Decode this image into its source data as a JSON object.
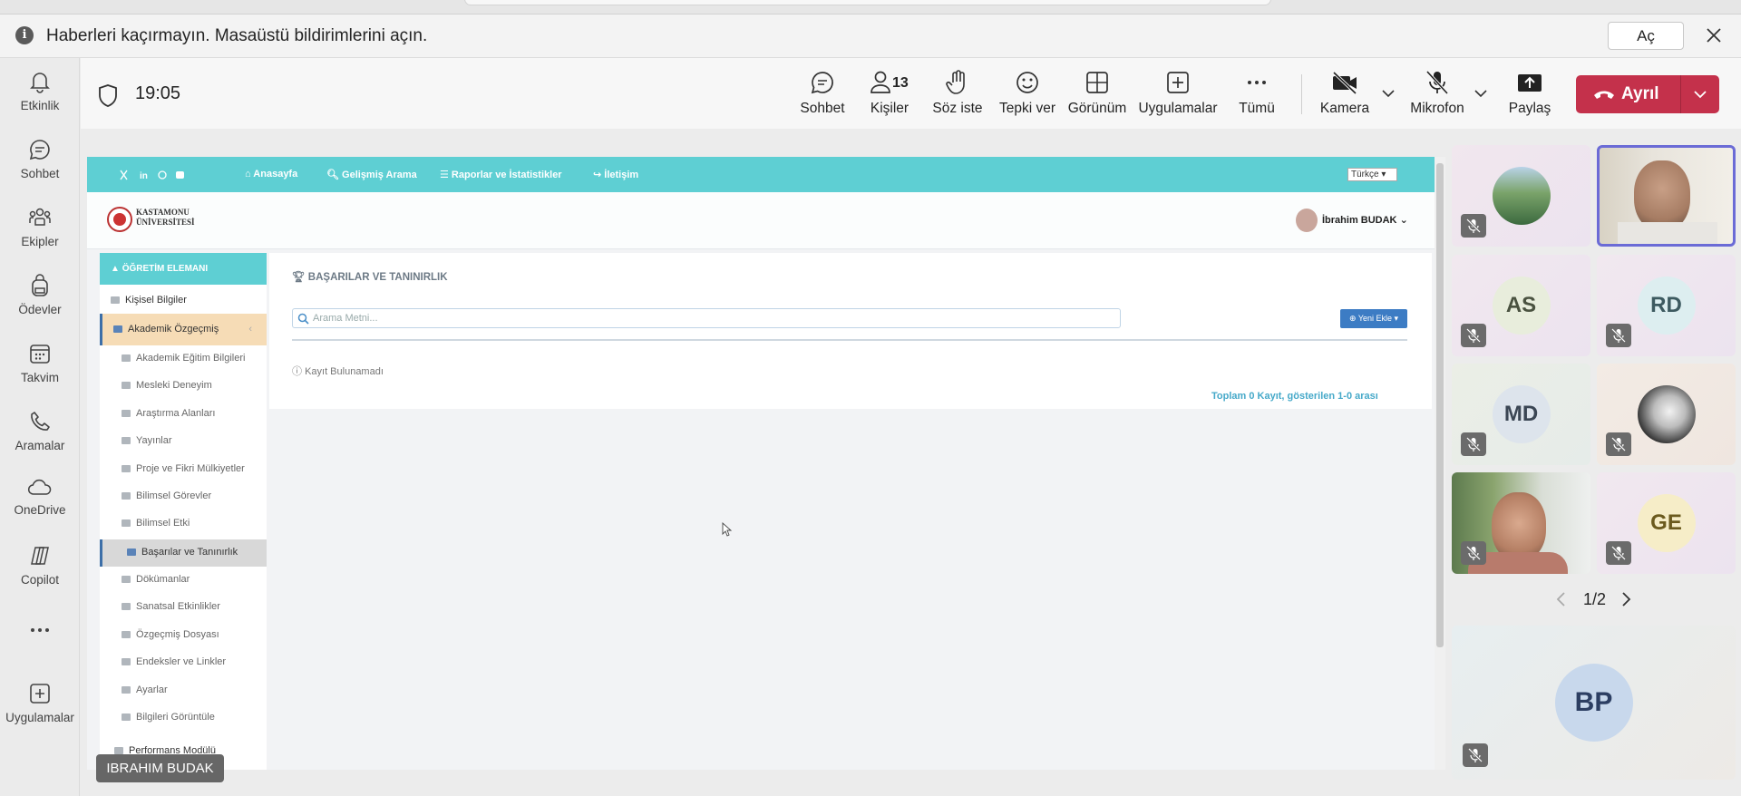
{
  "notification": {
    "text": "Haberleri kaçırmayın. Masaüstü bildirimlerini açın.",
    "button": "Aç"
  },
  "rail": [
    {
      "label": "Etkinlik",
      "icon": "bell-icon"
    },
    {
      "label": "Sohbet",
      "icon": "chat-icon"
    },
    {
      "label": "Ekipler",
      "icon": "teams-icon"
    },
    {
      "label": "Ödevler",
      "icon": "backpack-icon"
    },
    {
      "label": "Takvim",
      "icon": "calendar-icon"
    },
    {
      "label": "Aramalar",
      "icon": "phone-icon"
    },
    {
      "label": "OneDrive",
      "icon": "cloud-icon"
    },
    {
      "label": "Copilot",
      "icon": "copilot-icon"
    },
    {
      "label": "",
      "icon": "more-icon"
    },
    {
      "label": "Uygulamalar",
      "icon": "add-app-icon"
    }
  ],
  "meeting": {
    "time": "19:05",
    "people_count": "13",
    "toolbar": {
      "chat": "Sohbet",
      "people": "Kişiler",
      "raise": "Söz iste",
      "react": "Tepki ver",
      "view": "Görünüm",
      "apps": "Uygulamalar",
      "more": "Tümü",
      "camera": "Kamera",
      "mic": "Mikrofon",
      "share": "Paylaş",
      "leave": "Ayrıl"
    }
  },
  "shared": {
    "nav": [
      "Anasayfa",
      "Gelişmiş Arama",
      "Raporlar ve İstatistikler",
      "İletişim"
    ],
    "language": "Türkçe",
    "logo_line1": "KASTAMONU",
    "logo_line2": "ÜNİVERSİTESİ",
    "user": "İbrahim BUDAK",
    "side_header": "ÖĞRETİM ELEMANI",
    "side_items": [
      "Kişisel Bilgiler",
      "Akademik Özgeçmiş",
      "Akademik Eğitim Bilgileri",
      "Mesleki Deneyim",
      "Araştırma Alanları",
      "Yayınlar",
      "Proje ve Fikri Mülkiyetler",
      "Bilimsel Görevler",
      "Bilimsel Etki",
      "Başarılar ve Tanınırlık",
      "Dökümanlar",
      "Sanatsal Etkinlikler",
      "Özgeçmiş Dosyası",
      "Endeksler ve Linkler",
      "Ayarlar",
      "Bilgileri Görüntüle",
      "Performans Modülü"
    ],
    "page_title": "BAŞARILAR VE TANINIRLIK",
    "search_placeholder": "Arama Metni...",
    "new_button": "Yeni Ekle",
    "empty": "Kayıt Bulunamadı",
    "total": "Toplam 0 Kayıt, gösterilen 1-0 arası",
    "presenter": "IBRAHIM BUDAK"
  },
  "participants": [
    {
      "initials": "",
      "kind": "photo-landscape"
    },
    {
      "initials": "",
      "kind": "video-active"
    },
    {
      "initials": "AS",
      "color": "#e8eddc",
      "text": "#4a5240"
    },
    {
      "initials": "RD",
      "color": "#ddeef0",
      "text": "#3d5a60"
    },
    {
      "initials": "MD",
      "color": "#dde4ec",
      "text": "#3b4654"
    },
    {
      "initials": "",
      "kind": "photo-bw"
    },
    {
      "initials": "",
      "kind": "video"
    },
    {
      "initials": "GE",
      "color": "#f6edc8",
      "text": "#6b5a1e"
    },
    {
      "initials": "BP",
      "color": "#c8d8ec",
      "text": "#2c3e62"
    }
  ],
  "pager": "1/2"
}
